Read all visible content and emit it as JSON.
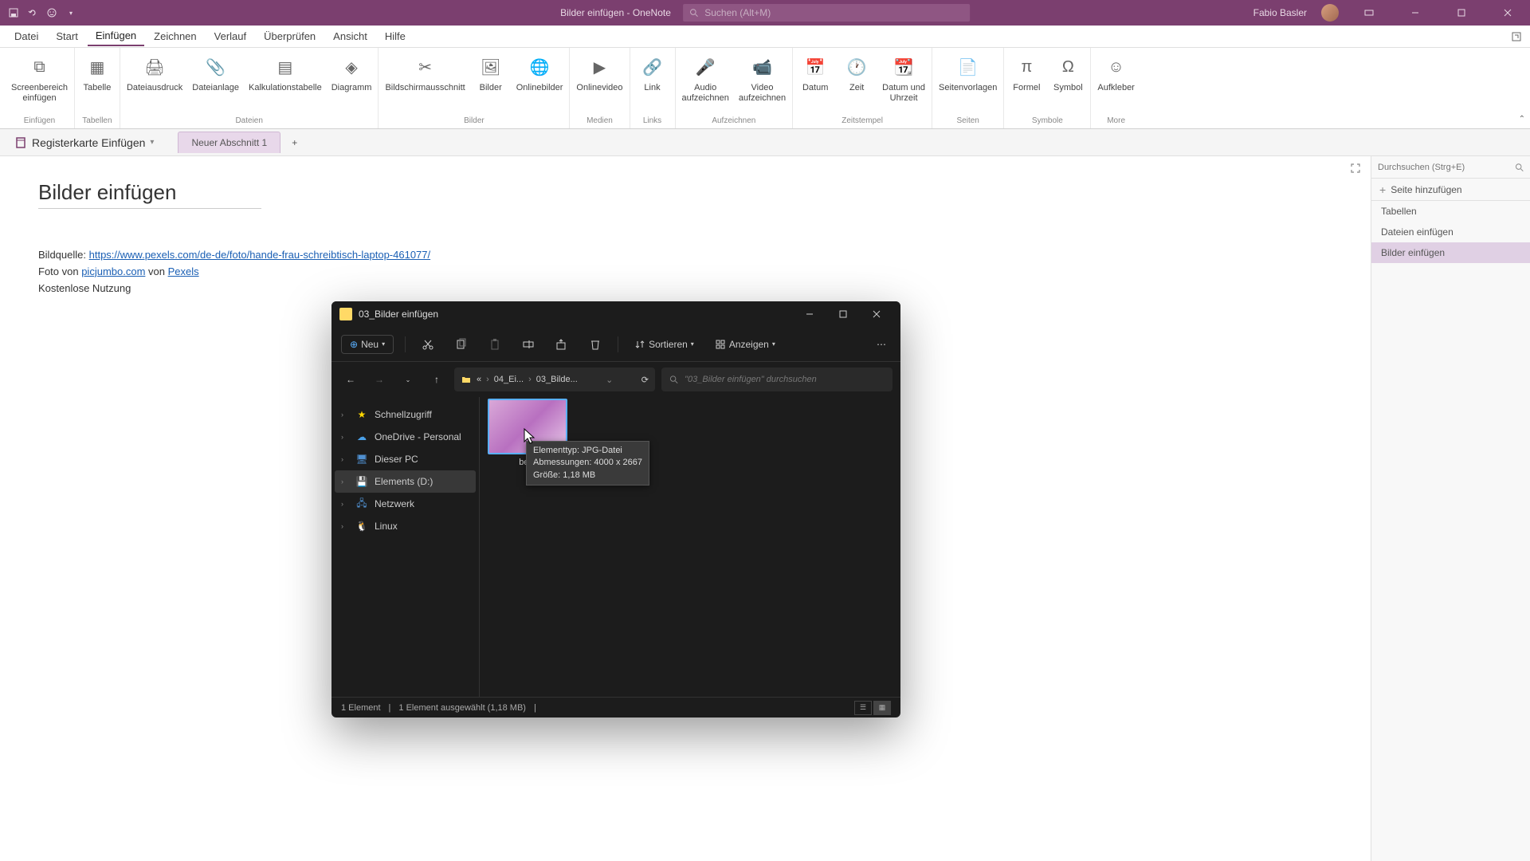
{
  "titlebar": {
    "doc_title": "Bilder einfügen",
    "app_name": "OneNote",
    "search_placeholder": "Suchen (Alt+M)",
    "user_name": "Fabio Basler"
  },
  "menu_tabs": [
    "Datei",
    "Start",
    "Einfügen",
    "Zeichnen",
    "Verlauf",
    "Überprüfen",
    "Ansicht",
    "Hilfe"
  ],
  "menu_active_index": 2,
  "ribbon": [
    {
      "label": "Einfügen",
      "items": [
        {
          "icon": "screenshot",
          "label": "Screenbereich\neinfügen"
        }
      ]
    },
    {
      "label": "Tabellen",
      "items": [
        {
          "icon": "table",
          "label": "Tabelle"
        }
      ]
    },
    {
      "label": "Dateien",
      "items": [
        {
          "icon": "printout",
          "label": "Dateiausdruck"
        },
        {
          "icon": "attach",
          "label": "Dateianlage"
        },
        {
          "icon": "excel",
          "label": "Kalkulationstabelle"
        },
        {
          "icon": "visio",
          "label": "Diagramm"
        }
      ]
    },
    {
      "label": "Bilder",
      "items": [
        {
          "icon": "clip",
          "label": "Bildschirmausschnitt"
        },
        {
          "icon": "image",
          "label": "Bilder"
        },
        {
          "icon": "online-image",
          "label": "Onlinebilder"
        }
      ]
    },
    {
      "label": "Medien",
      "items": [
        {
          "icon": "video",
          "label": "Onlinevideo"
        }
      ]
    },
    {
      "label": "Links",
      "items": [
        {
          "icon": "link",
          "label": "Link"
        }
      ]
    },
    {
      "label": "Aufzeichnen",
      "items": [
        {
          "icon": "audio",
          "label": "Audio\naufzeichnen"
        },
        {
          "icon": "video-rec",
          "label": "Video\naufzeichnen"
        }
      ]
    },
    {
      "label": "Zeitstempel",
      "items": [
        {
          "icon": "date",
          "label": "Datum"
        },
        {
          "icon": "time",
          "label": "Zeit"
        },
        {
          "icon": "datetime",
          "label": "Datum und\nUhrzeit"
        }
      ]
    },
    {
      "label": "Seiten",
      "items": [
        {
          "icon": "template",
          "label": "Seitenvorlagen"
        }
      ]
    },
    {
      "label": "Symbole",
      "items": [
        {
          "icon": "formula",
          "label": "Formel"
        },
        {
          "icon": "symbol",
          "label": "Symbol"
        }
      ]
    },
    {
      "label": "More",
      "items": [
        {
          "icon": "sticker",
          "label": "Aufkleber"
        }
      ]
    }
  ],
  "notebook": {
    "title": "Registerkarte Einfügen",
    "sections": [
      "Neuer Abschnitt 1"
    ]
  },
  "page": {
    "title": "Bilder einfügen",
    "source_label": "Bildquelle: ",
    "source_url": "https://www.pexels.com/de-de/foto/hande-frau-schreibtisch-laptop-461077/",
    "credit_prefix": "Foto von ",
    "credit_author": "picjumbo.com",
    "credit_mid": " von ",
    "credit_site": "Pexels",
    "license": "Kostenlose Nutzung"
  },
  "pages_panel": {
    "search_placeholder": "Durchsuchen (Strg+E)",
    "add_label": "Seite hinzufügen",
    "items": [
      "Tabellen",
      "Dateien einfügen",
      "Bilder einfügen"
    ],
    "selected_index": 2
  },
  "explorer": {
    "title": "03_Bilder einfügen",
    "new_btn": "Neu",
    "sort_btn": "Sortieren",
    "view_btn": "Anzeigen",
    "path": [
      "«",
      "04_Ei...",
      "03_Bilde..."
    ],
    "search_placeholder": "\"03_Bilder einfügen\" durchsuchen",
    "tree": [
      {
        "icon": "star",
        "label": "Schnellzugriff",
        "color": "#ffd700"
      },
      {
        "icon": "cloud",
        "label": "OneDrive - Personal",
        "color": "#4aa0e8"
      },
      {
        "icon": "pc",
        "label": "Dieser PC",
        "color": "#5090d0"
      },
      {
        "icon": "drive",
        "label": "Elements (D:)",
        "color": "#ccc",
        "selected": true
      },
      {
        "icon": "network",
        "label": "Netzwerk",
        "color": "#5090d0"
      },
      {
        "icon": "linux",
        "label": "Linux",
        "color": "#fff"
      }
    ],
    "file_label": "be...",
    "tooltip": {
      "line1": "Elementtyp: JPG-Datei",
      "line2": "Abmessungen: 4000 x 2667",
      "line3": "Größe: 1,18 MB"
    },
    "status": {
      "count": "1 Element",
      "selected": "1 Element ausgewählt (1,18 MB)"
    }
  }
}
